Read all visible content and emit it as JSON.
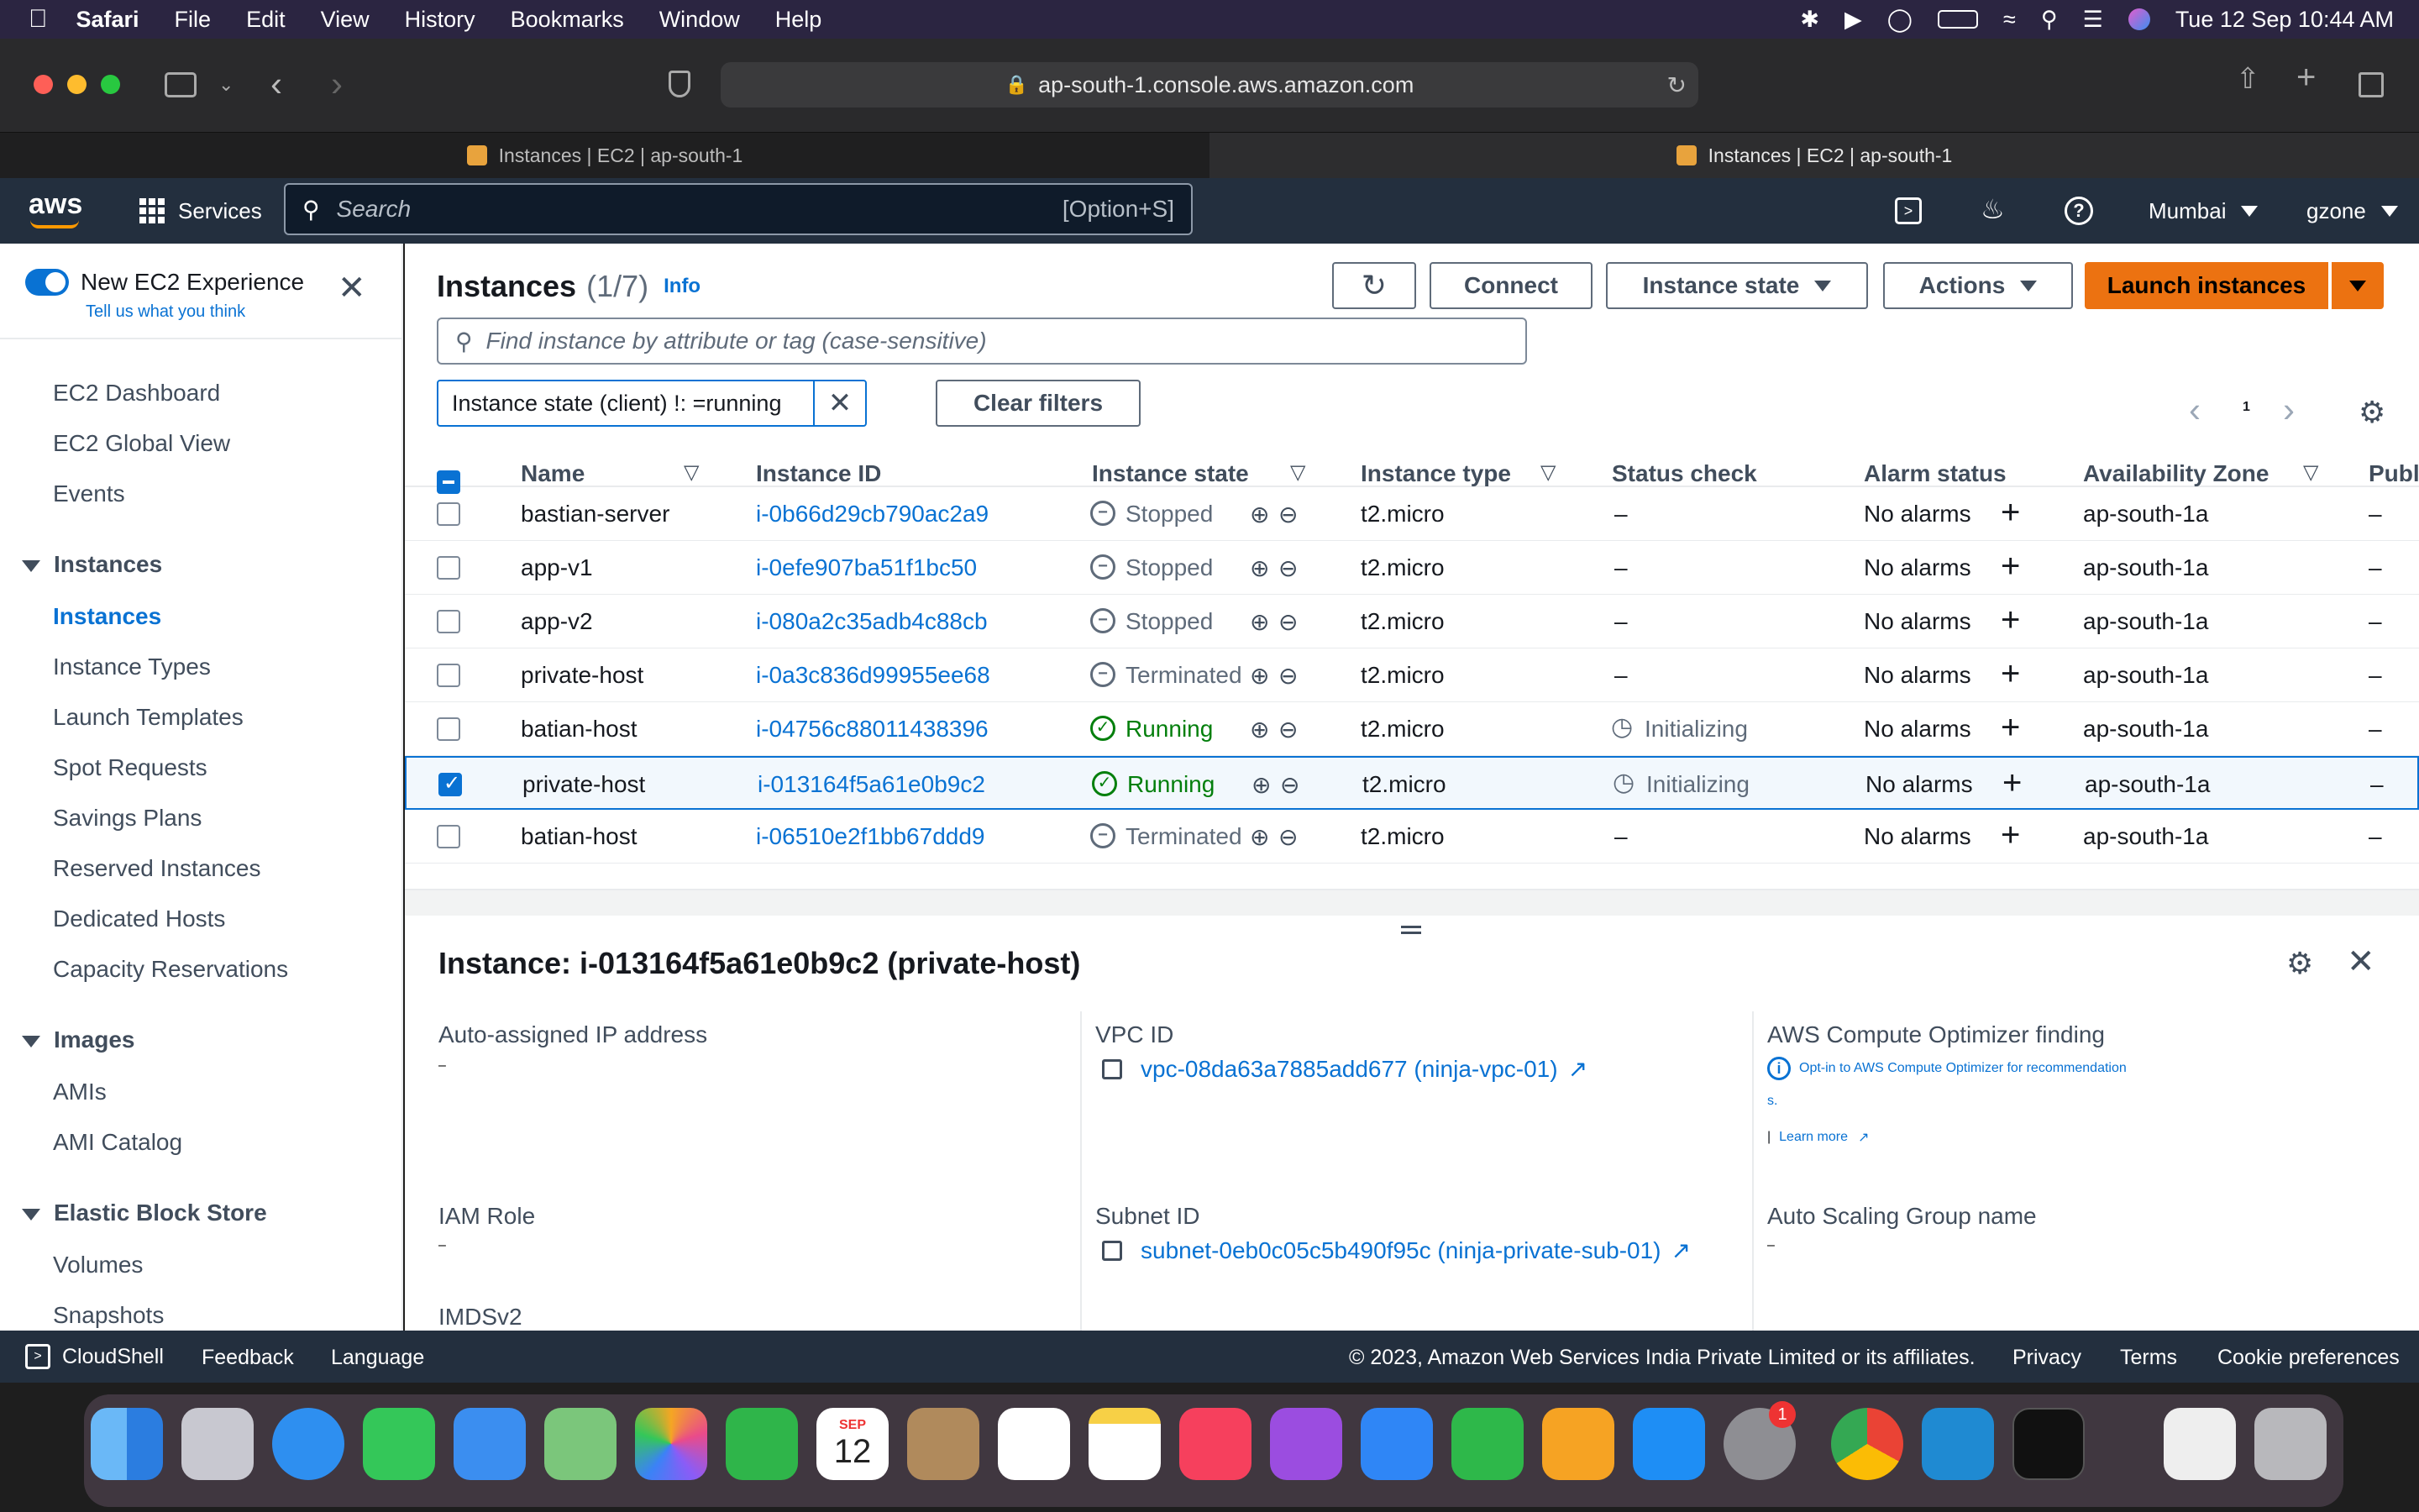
{
  "menubar": {
    "app": "Safari",
    "items": [
      "File",
      "Edit",
      "View",
      "History",
      "Bookmarks",
      "Window",
      "Help"
    ],
    "clock": "Tue 12 Sep  10:44 AM"
  },
  "browser": {
    "url": "ap-south-1.console.aws.amazon.com",
    "tabs": [
      {
        "label": "Instances | EC2 | ap-south-1"
      },
      {
        "label": "Instances | EC2 | ap-south-1"
      }
    ]
  },
  "aws": {
    "logo": "aws",
    "services": "Services",
    "search_placeholder": "Search",
    "search_shortcut": "[Option+S]",
    "region": "Mumbai",
    "account": "gzone"
  },
  "sidebar": {
    "new_exp": "New EC2 Experience",
    "tell_us": "Tell us what you think",
    "top_items": [
      "EC2 Dashboard",
      "EC2 Global View",
      "Events"
    ],
    "instances_header": "Instances",
    "instances_items": [
      "Instances",
      "Instance Types",
      "Launch Templates",
      "Spot Requests",
      "Savings Plans",
      "Reserved Instances",
      "Dedicated Hosts",
      "Capacity Reservations"
    ],
    "images_header": "Images",
    "images_items": [
      "AMIs",
      "AMI Catalog"
    ],
    "ebs_header": "Elastic Block Store",
    "ebs_items": [
      "Volumes",
      "Snapshots"
    ]
  },
  "main": {
    "title": "Instances",
    "count": "(1/7)",
    "info": "Info",
    "connect": "Connect",
    "instance_state": "Instance state",
    "actions": "Actions",
    "launch": "Launch instances",
    "find_placeholder": "Find instance by attribute or tag (case-sensitive)",
    "filter_token": "Instance state (client) !: =running",
    "clear_filters": "Clear filters",
    "page": "1",
    "columns": [
      "Name",
      "Instance ID",
      "Instance state",
      "Instance type",
      "Status check",
      "Alarm status",
      "Availability Zone",
      "Publ"
    ],
    "rows": [
      {
        "name": "bastian-server",
        "id": "i-0b66d29cb790ac2a9",
        "state": "Stopped",
        "type": "t2.micro",
        "status": "–",
        "alarm": "No alarms",
        "az": "ap-south-1a",
        "pub": "–"
      },
      {
        "name": "app-v1",
        "id": "i-0efe907ba51f1bc50",
        "state": "Stopped",
        "type": "t2.micro",
        "status": "–",
        "alarm": "No alarms",
        "az": "ap-south-1a",
        "pub": "–"
      },
      {
        "name": "app-v2",
        "id": "i-080a2c35adb4c88cb",
        "state": "Stopped",
        "type": "t2.micro",
        "status": "–",
        "alarm": "No alarms",
        "az": "ap-south-1a",
        "pub": "–"
      },
      {
        "name": "private-host",
        "id": "i-0a3c836d99955ee68",
        "state": "Terminated",
        "type": "t2.micro",
        "status": "–",
        "alarm": "No alarms",
        "az": "ap-south-1a",
        "pub": "–"
      },
      {
        "name": "batian-host",
        "id": "i-04756c88011438396",
        "state": "Running",
        "type": "t2.micro",
        "status": "Initializing",
        "alarm": "No alarms",
        "az": "ap-south-1a",
        "pub": "–"
      },
      {
        "name": "private-host",
        "id": "i-013164f5a61e0b9c2",
        "state": "Running",
        "type": "t2.micro",
        "status": "Initializing",
        "alarm": "No alarms",
        "az": "ap-south-1a",
        "pub": "–"
      },
      {
        "name": "batian-host",
        "id": "i-06510e2f1bb67ddd9",
        "state": "Terminated",
        "type": "t2.micro",
        "status": "–",
        "alarm": "No alarms",
        "az": "ap-south-1a",
        "pub": "–"
      }
    ]
  },
  "detail": {
    "title": "Instance: i-013164f5a61e0b9c2 (private-host)",
    "auto_ip_label": "Auto-assigned IP address",
    "auto_ip": "–",
    "vpc_label": "VPC ID",
    "vpc": "vpc-08da63a7885add677 (ninja-vpc-01)",
    "optimizer_label": "AWS Compute Optimizer finding",
    "optimizer_line1": "Opt-in to AWS Compute Optimizer for recommendation",
    "optimizer_line2": "s.",
    "learn_more": "Learn more",
    "iam_label": "IAM Role",
    "iam": "–",
    "subnet_label": "Subnet ID",
    "subnet": "subnet-0eb0c05c5b490f95c (ninja-private-sub-01)",
    "asg_label": "Auto Scaling Group name",
    "asg": "–",
    "imds_label": "IMDSv2"
  },
  "footer": {
    "cloudshell": "CloudShell",
    "feedback": "Feedback",
    "language": "Language",
    "copyright": "© 2023, Amazon Web Services India Private Limited or its affiliates.",
    "privacy": "Privacy",
    "terms": "Terms",
    "cookies": "Cookie preferences"
  },
  "dock": {
    "calendar_month": "SEP",
    "calendar_day": "12",
    "badge": "1"
  },
  "colors": {
    "aws_header": "#232f3e",
    "link": "#0972d3",
    "launch": "#ec7211",
    "running": "#037f0c",
    "stopped": "#5f6b7a"
  }
}
